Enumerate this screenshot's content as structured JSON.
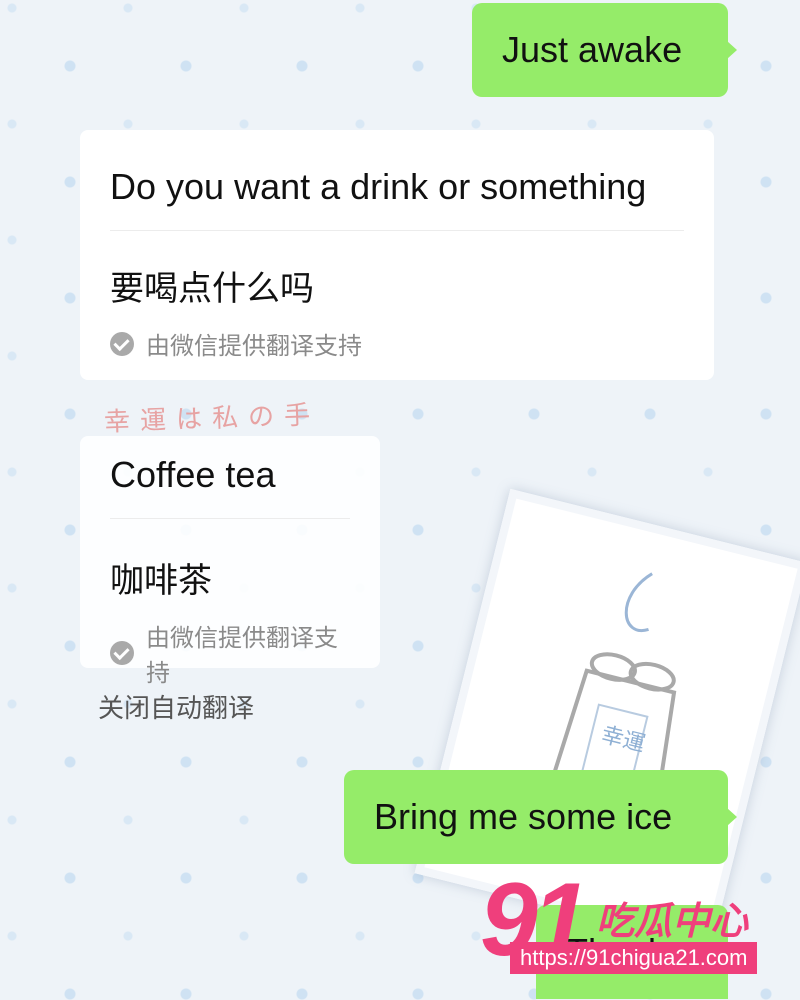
{
  "messages": {
    "sent_1": "Just awake",
    "received_1": {
      "text": "Do you want a drink or something",
      "translation": "要喝点什么吗",
      "translation_note": "由微信提供翻译支持"
    },
    "received_2": {
      "text": "Coffee tea",
      "translation": "咖啡茶",
      "translation_note": "由微信提供翻译支持"
    },
    "sent_2": "Bring me some ice",
    "sent_3": "Thank u"
  },
  "actions": {
    "close_auto_translate": "关闭自动翻译"
  },
  "sticker": {
    "caption": "幸運は私の手",
    "tag_chars": "幸運"
  },
  "watermark": {
    "number": "91",
    "brand": "吃瓜中心",
    "url": "https://91chigua21.com"
  },
  "colors": {
    "sent_bubble": "#95ec69",
    "received_bubble": "#ffffff",
    "watermark": "#ef3f7c"
  },
  "icons": {
    "translation_check": "check-circle-icon"
  }
}
